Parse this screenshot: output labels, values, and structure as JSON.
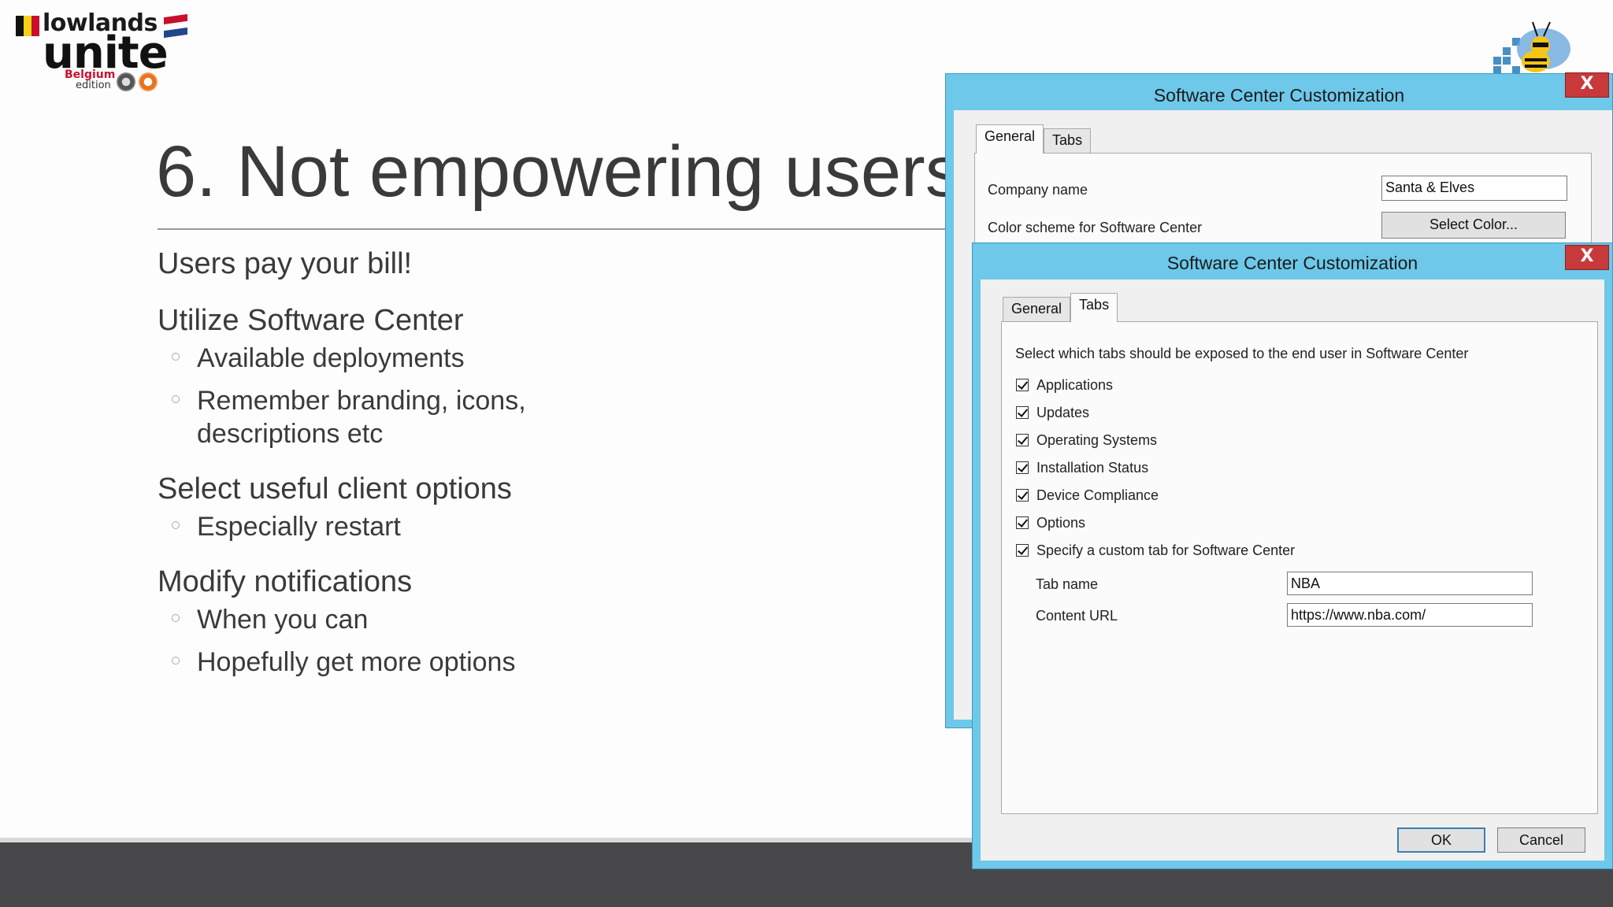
{
  "slide": {
    "logo": {
      "word1": "lowlands",
      "word2": "unite",
      "edition_line1": "Belgium",
      "edition_line2": "edition"
    },
    "title": "6. Not empowering users",
    "bullets": [
      {
        "text": "Users pay your bill!",
        "subs": []
      },
      {
        "text": "Utilize Software Center",
        "subs": [
          "Available deployments",
          "Remember branding, icons,",
          "descriptions etc"
        ]
      },
      {
        "text": "Select useful client options",
        "subs": [
          "Especially restart"
        ]
      },
      {
        "text": "Modify notifications",
        "subs": [
          "When you can",
          "Hopefully get more options"
        ]
      }
    ],
    "colors": {
      "title": "#3a3a3a",
      "bottom_bar": "#48484a",
      "dialog_frame": "#6dc8ea",
      "close_button": "#c8393b"
    }
  },
  "dialog_back": {
    "title": "Software Center Customization",
    "close_label": "X",
    "tabs": [
      "General",
      "Tabs"
    ],
    "active_tab": "General",
    "company_name_label": "Company name",
    "company_name_value": "Santa & Elves",
    "color_scheme_label": "Color scheme for Software Center",
    "select_color_label": "Select Color..."
  },
  "dialog_front": {
    "title": "Software Center Customization",
    "close_label": "X",
    "tabs": [
      "General",
      "Tabs"
    ],
    "active_tab": "Tabs",
    "instruction": "Select which tabs should be exposed to the end user in Software Center",
    "checkboxes": [
      {
        "label": "Applications",
        "checked": true
      },
      {
        "label": "Updates",
        "checked": true
      },
      {
        "label": "Operating Systems",
        "checked": true
      },
      {
        "label": "Installation Status",
        "checked": true
      },
      {
        "label": "Device Compliance",
        "checked": true
      },
      {
        "label": "Options",
        "checked": true
      },
      {
        "label": "Specify a custom tab for Software Center",
        "checked": true
      }
    ],
    "tab_name_label": "Tab name",
    "tab_name_value": "NBA",
    "content_url_label": "Content URL",
    "content_url_value": "https://www.nba.com/",
    "ok_label": "OK",
    "cancel_label": "Cancel"
  }
}
